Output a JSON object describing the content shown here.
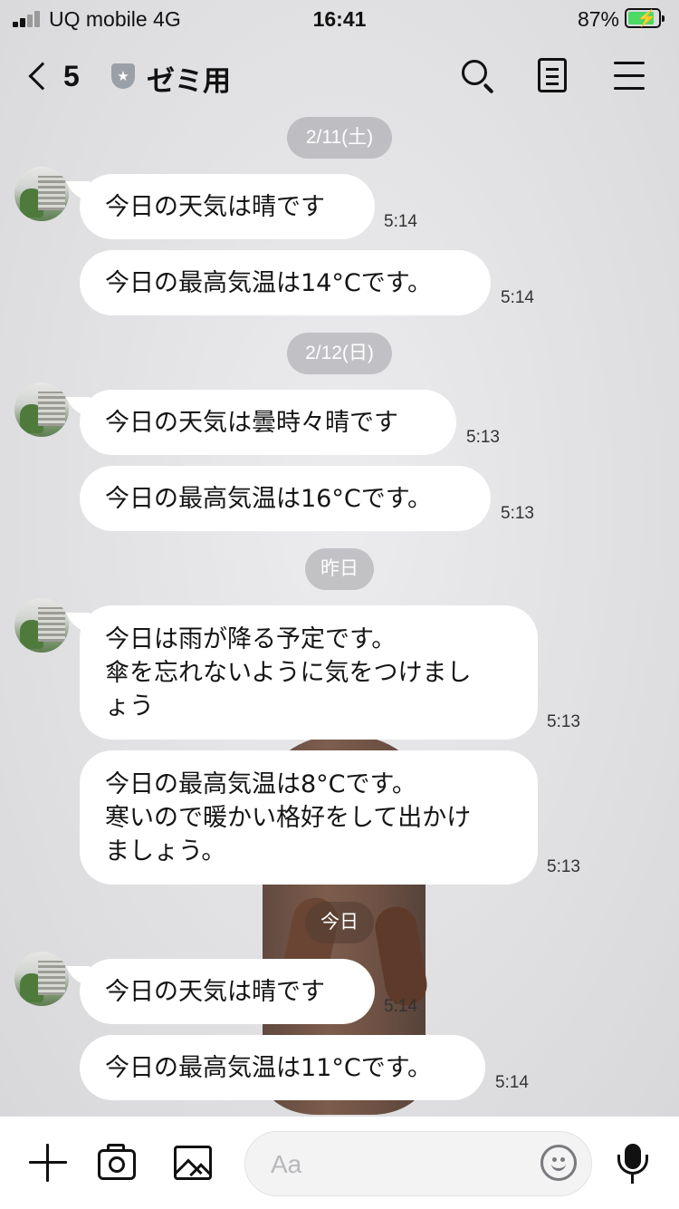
{
  "status_bar": {
    "carrier": "UQ mobile   4G",
    "time": "16:41",
    "battery": "87%"
  },
  "header": {
    "back_count": "5",
    "title": "ゼミ用"
  },
  "chat": {
    "dates": [
      "2/11(土)",
      "2/12(日)",
      "昨日",
      "今日"
    ],
    "messages": [
      {
        "text": "今日の天気は晴です",
        "time": "5:14"
      },
      {
        "text": "今日の最高気温は14°Cです。",
        "time": "5:14"
      },
      {
        "text": "今日の天気は曇時々晴です",
        "time": "5:13"
      },
      {
        "text": "今日の最高気温は16°Cです。",
        "time": "5:13"
      },
      {
        "text": "今日は雨が降る予定です。\n傘を忘れないように気をつけまし\nょう",
        "time": "5:13"
      },
      {
        "text": "今日の最高気温は8°Cです。\n寒いので暖かい格好をして出かけ\nましょう。",
        "time": "5:13"
      },
      {
        "text": "今日の天気は晴です",
        "time": "5:14"
      },
      {
        "text": "今日の最高気温は11°Cです。",
        "time": "5:14"
      }
    ]
  },
  "input": {
    "placeholder": "Aa"
  },
  "icons": {
    "plus": "plus-icon",
    "camera": "camera-icon",
    "image": "image-icon",
    "emoji": "smile-icon",
    "mic": "microphone-icon"
  },
  "colors": {
    "bubble": "#ffffff",
    "background": "#e2e2e4",
    "battery_fill": "#4cd964"
  }
}
